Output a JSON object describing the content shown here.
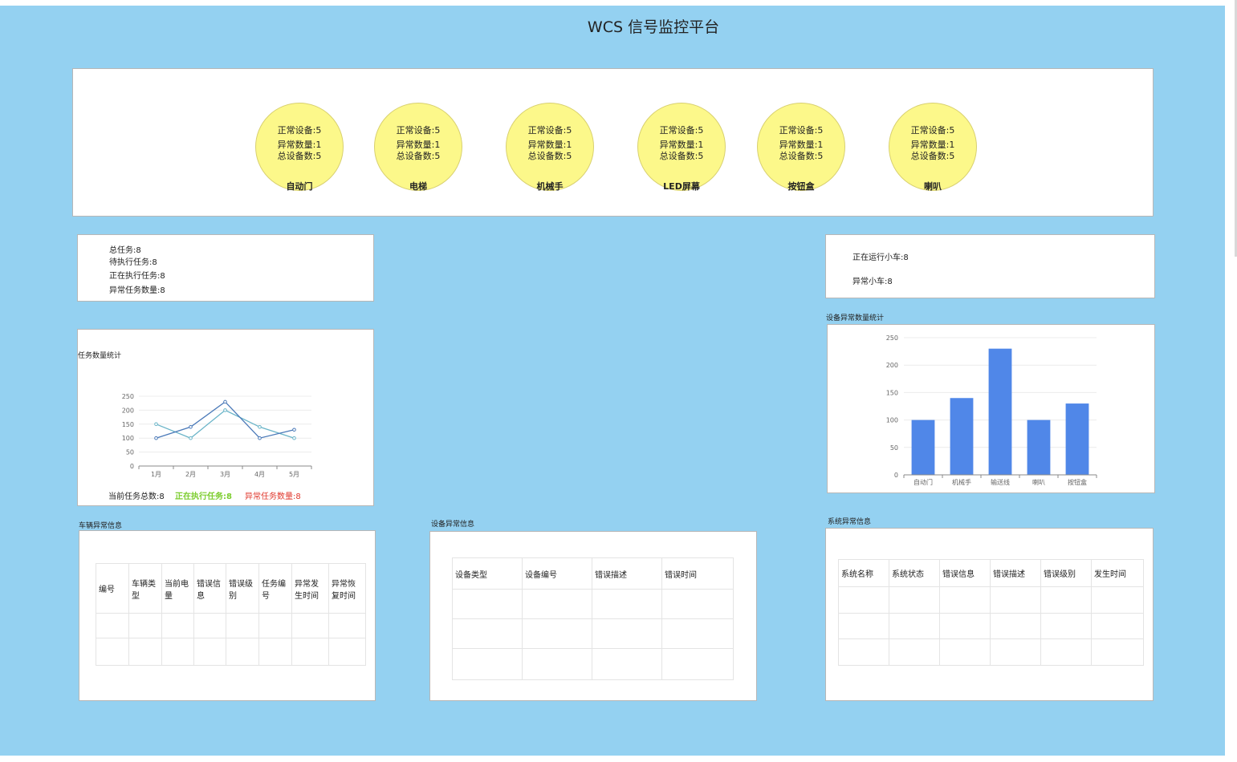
{
  "title": "WCS 信号监控平台",
  "devices": [
    {
      "name": "自动门",
      "normal": "正常设备:5",
      "abnormal": "异常数量:1",
      "total": "总设备数:5"
    },
    {
      "name": "电梯",
      "normal": "正常设备:5",
      "abnormal": "异常数量:1",
      "total": "总设备数:5"
    },
    {
      "name": "机械手",
      "normal": "正常设备:5",
      "abnormal": "异常数量:1",
      "total": "总设备数:5"
    },
    {
      "name": "LED屏幕",
      "normal": "正常设备:5",
      "abnormal": "异常数量:1",
      "total": "总设备数:5"
    },
    {
      "name": "按钮盒",
      "normal": "正常设备:5",
      "abnormal": "异常数量:1",
      "total": "总设备数:5"
    },
    {
      "name": "喇叭",
      "normal": "正常设备:5",
      "abnormal": "异常数量:1",
      "total": "总设备数:5"
    }
  ],
  "tasks": {
    "total": "总任务:8",
    "pending": "待执行任务:8",
    "running": "正在执行任务:8",
    "abnormal": "异常任务数量:8"
  },
  "cars": {
    "running": "正在运行小车:8",
    "abnormal": "异常小车:8"
  },
  "task_chart": {
    "title": "任务数量统计",
    "footer": {
      "current": "当前任务总数:8",
      "running": "正在执行任务:8",
      "abnormal": "异常任务数量:8"
    }
  },
  "device_chart_title": "设备异常数量统计",
  "chart_data": [
    {
      "type": "line",
      "categories": [
        "1月",
        "2月",
        "3月",
        "4月",
        "5月"
      ],
      "yticks": [
        "0",
        "50",
        "100",
        "150",
        "200",
        "250"
      ],
      "ylim": [
        0,
        250
      ],
      "series": [
        {
          "values": [
            100,
            140,
            230,
            100,
            130
          ],
          "color": "#4a79b8"
        },
        {
          "values": [
            150,
            100,
            200,
            140,
            100
          ],
          "color": "#6ab4c8"
        }
      ]
    },
    {
      "type": "bar",
      "categories": [
        "自动门",
        "机械手",
        "输送线",
        "喇叭",
        "按钮盒"
      ],
      "values": [
        100,
        140,
        230,
        100,
        130
      ],
      "yticks": [
        "0",
        "50",
        "100",
        "150",
        "200",
        "250"
      ],
      "ylim": [
        0,
        250
      ],
      "color": "#5087e8"
    }
  ],
  "vehicle_table": {
    "title": "车辆异常信息",
    "headers": [
      "编号",
      "车辆类型",
      "当前电量",
      "错误信息",
      "错误级别",
      "任务编号",
      "异常发生时间",
      "异常恢复时间"
    ]
  },
  "device_table": {
    "title": "设备异常信息",
    "headers": [
      "设备类型",
      "设备编号",
      "错误描述",
      "错误时间"
    ]
  },
  "system_table": {
    "title": "系统异常信息",
    "headers": [
      "系统名称",
      "系统状态",
      "错误信息",
      "错误描述",
      "错误级别",
      "发生时间"
    ]
  },
  "colors": {
    "background": "#94d1f1",
    "circle": "#fcf88a",
    "running_text": "#7ccd2e",
    "abnormal_text": "#e0372c"
  }
}
